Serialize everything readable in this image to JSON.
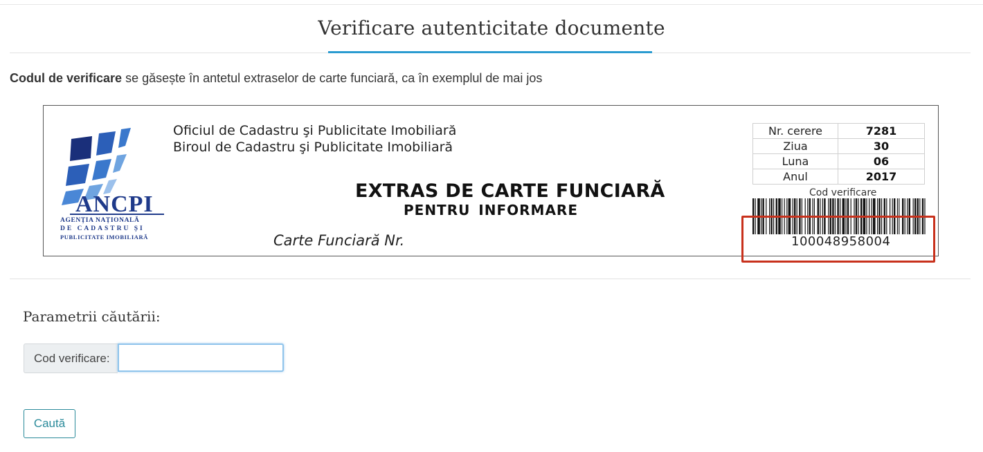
{
  "header": {
    "title": "Verificare autenticitate documente"
  },
  "intro": {
    "bold": "Codul de verificare",
    "rest": " se găsește în antetul extraselor de carte funciară, ca în exemplul de mai jos"
  },
  "sample": {
    "logo_name": "ANCPI",
    "logo_line1": "AGENȚIA NAȚIONALĂ",
    "logo_line2": "DE CADASTRU ȘI",
    "logo_line3": "PUBLICITATE IMOBILIARĂ",
    "office_line1": "Oficiul de Cadastru şi Publicitate Imobiliară",
    "office_line2": "Biroul de Cadastru şi Publicitate Imobiliară",
    "doc_title": "EXTRAS DE CARTE FUNCIARĂ",
    "doc_subtitle": "PENTRU  INFORMARE",
    "cf_label": "Carte Funciară Nr.",
    "table": [
      {
        "k": "Nr. cerere",
        "v": "7281"
      },
      {
        "k": "Ziua",
        "v": "30"
      },
      {
        "k": "Luna",
        "v": "06"
      },
      {
        "k": "Anul",
        "v": "2017"
      }
    ],
    "code_label": "Cod verificare",
    "code_number": "100048958004",
    "highlight_color": "#c8311c"
  },
  "search": {
    "section_title": "Parametrii căutării:",
    "field_label": "Cod verificare:",
    "field_value": "",
    "button_label": "Caută"
  },
  "colors": {
    "accent": "#2a9bd0",
    "button": "#2a8a9a"
  }
}
